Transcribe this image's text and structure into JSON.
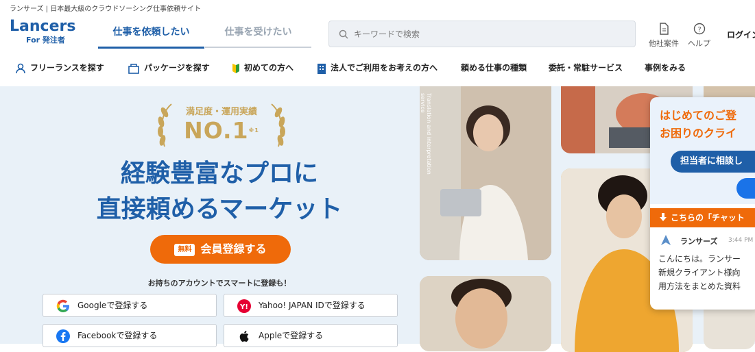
{
  "header": {
    "tagline": "ランサーズ | 日本最大級のクラウドソーシング仕事依頼サイト",
    "logo_word": "Lancers",
    "logo_sub": "For 発注者",
    "tabs": [
      {
        "label": "仕事を依頼したい"
      },
      {
        "label": "仕事を受けたい"
      }
    ],
    "search_placeholder": "キーワードで検索",
    "utils": [
      {
        "label": "他社案件",
        "icon": "document-icon"
      },
      {
        "label": "ヘルプ",
        "icon": "help-icon"
      }
    ],
    "login": "ログイン"
  },
  "nav": {
    "items": [
      {
        "label": "フリーランスを探す",
        "icon": "person-icon"
      },
      {
        "label": "パッケージを探す",
        "icon": "package-icon"
      },
      {
        "label": "初めての方へ",
        "icon": "beginner-icon"
      },
      {
        "label": "法人でご利用をお考えの方へ",
        "icon": "building-icon"
      },
      {
        "label": "頼める仕事の種類"
      },
      {
        "label": "委託・常駐サービス"
      },
      {
        "label": "事例をみる"
      }
    ]
  },
  "hero": {
    "badge_top": "満足度・運用実績",
    "badge_no1": "NO.1",
    "badge_note": "※1",
    "headline_line1": "経験豊富なプロに",
    "headline_line2": "直接頼めるマーケット",
    "cta_free": "無料",
    "cta_label": "会員登録する",
    "social_note": "お持ちのアカウントでスマートに登録も！",
    "social_buttons": [
      {
        "label": "Googleで登録する",
        "icon": "google-icon"
      },
      {
        "label": "Yahoo! JAPAN IDで登録する",
        "icon": "yahoo-icon"
      },
      {
        "label": "Facebookで登録する",
        "icon": "facebook-icon"
      },
      {
        "label": "Appleで登録する",
        "icon": "apple-icon"
      }
    ],
    "photo_caption": "Translation and interpretation service"
  },
  "chat": {
    "title_line1": "はじめてのご登",
    "title_line2": "お困りのクライ",
    "consult": "担当者に相談し",
    "notice": "こちらの「チャット",
    "name": "ランサーズ",
    "time": "3:44 PM",
    "msg_lines": [
      "こんにちは。ランサー",
      "新規クライアント様向",
      "用方法をまとめた資料"
    ]
  },
  "colors": {
    "brand_blue": "#1f5fa8",
    "accent_orange": "#ef6a0a",
    "gold": "#c9a65a",
    "hero_bg": "#e9f1f8"
  }
}
